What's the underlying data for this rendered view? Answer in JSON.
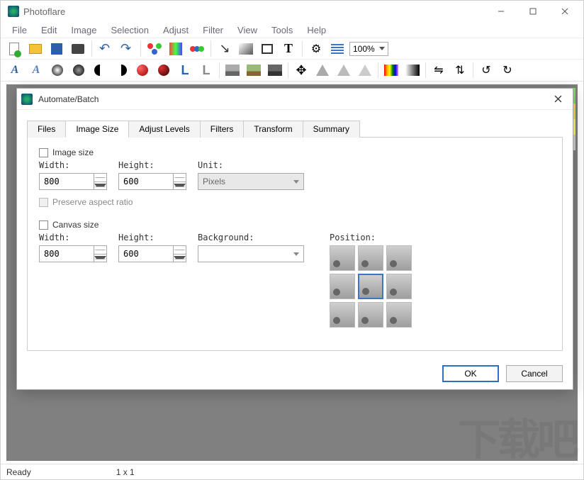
{
  "app": {
    "title": "Photoflare"
  },
  "menus": [
    "File",
    "Edit",
    "Image",
    "Selection",
    "Adjust",
    "Filter",
    "View",
    "Tools",
    "Help"
  ],
  "zoom": "100%",
  "status": {
    "left": "Ready",
    "size": "1 x 1"
  },
  "dialog": {
    "title": "Automate/Batch",
    "tabs": [
      "Files",
      "Image Size",
      "Adjust Levels",
      "Filters",
      "Transform",
      "Summary"
    ],
    "active_tab": 1,
    "image_size": {
      "label": "Image size",
      "width_label": "Width:",
      "width_value": "800",
      "height_label": "Height:",
      "height_value": "600",
      "unit_label": "Unit:",
      "unit_value": "Pixels",
      "preserve_label": "Preserve aspect ratio"
    },
    "canvas_size": {
      "label": "Canvas size",
      "width_label": "Width:",
      "width_value": "800",
      "height_label": "Height:",
      "height_value": "600",
      "background_label": "Background:",
      "background_value": "",
      "position_label": "Position:"
    },
    "buttons": {
      "ok": "OK",
      "cancel": "Cancel"
    }
  }
}
